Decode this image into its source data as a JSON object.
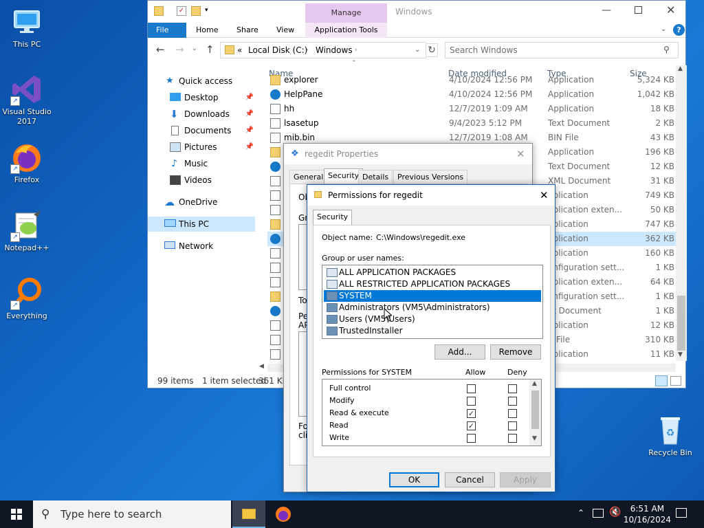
{
  "desktop": {
    "icons": [
      {
        "label": "This PC",
        "icon": "monitor-icon"
      },
      {
        "label": "Visual Studio 2017",
        "icon": "visual-studio-icon"
      },
      {
        "label": "Firefox",
        "icon": "firefox-icon"
      },
      {
        "label": "Notepad++",
        "icon": "notepad-plus-plus-icon"
      },
      {
        "label": "Everything",
        "icon": "everything-search-icon"
      },
      {
        "label": "Recycle Bin",
        "icon": "recycle-bin-icon"
      }
    ]
  },
  "explorer": {
    "title": "Windows",
    "manage_label": "Manage",
    "tabs": [
      "File",
      "Home",
      "Share",
      "View",
      "Application Tools"
    ],
    "breadcrumb": [
      "Local Disk (C:)",
      "Windows"
    ],
    "breadcrumb_prefix": "«",
    "search_placeholder": "Search Windows",
    "columns": {
      "name": "Name",
      "date": "Date modified",
      "type": "Type",
      "size": "Size"
    },
    "nav": [
      {
        "label": "Quick access",
        "icon": "star-icon",
        "pinned": false
      },
      {
        "label": "Desktop",
        "icon": "desktop-folder-icon",
        "pinned": true
      },
      {
        "label": "Downloads",
        "icon": "download-arrow-icon",
        "pinned": true
      },
      {
        "label": "Documents",
        "icon": "documents-icon",
        "pinned": true
      },
      {
        "label": "Pictures",
        "icon": "pictures-icon",
        "pinned": true
      },
      {
        "label": "Music",
        "icon": "music-note-icon",
        "pinned": false
      },
      {
        "label": "Videos",
        "icon": "videos-icon",
        "pinned": false
      },
      {
        "label": "OneDrive",
        "icon": "cloud-icon",
        "pinned": false
      },
      {
        "label": "This PC",
        "icon": "monitor-icon",
        "pinned": false
      },
      {
        "label": "Network",
        "icon": "network-icon",
        "pinned": false
      }
    ],
    "files": [
      {
        "name": "explorer",
        "date": "4/10/2024 12:56 PM",
        "type": "Application",
        "size": "5,324 KB"
      },
      {
        "name": "HelpPane",
        "date": "4/10/2024 12:56 PM",
        "type": "Application",
        "size": "1,042 KB"
      },
      {
        "name": "hh",
        "date": "12/7/2019 1:09 AM",
        "type": "Application",
        "size": "18 KB"
      },
      {
        "name": "lsasetup",
        "date": "9/4/2023 5:12 PM",
        "type": "Text Document",
        "size": "2 KB"
      },
      {
        "name": "mib.bin",
        "date": "12/7/2019 1:08 AM",
        "type": "BIN File",
        "size": "43 KB"
      },
      {
        "name": "",
        "date": "",
        "type": "Application",
        "size": "196 KB"
      },
      {
        "name": "",
        "date": "",
        "type": "Text Document",
        "size": "12 KB"
      },
      {
        "name": "",
        "date": "",
        "type": "XML Document",
        "size": "31 KB"
      },
      {
        "name": "",
        "date": "",
        "type": "pplication",
        "size": "749 KB"
      },
      {
        "name": "",
        "date": "",
        "type": "pplication exten...",
        "size": "50 KB"
      },
      {
        "name": "",
        "date": "",
        "type": "pplication",
        "size": "747 KB"
      },
      {
        "name": "",
        "date": "",
        "type": "pplication",
        "size": "362 KB"
      },
      {
        "name": "",
        "date": "",
        "type": "pplication",
        "size": "160 KB"
      },
      {
        "name": "",
        "date": "",
        "type": "onfiguration sett...",
        "size": "1 KB"
      },
      {
        "name": "",
        "date": "",
        "type": "pplication exten...",
        "size": "64 KB"
      },
      {
        "name": "",
        "date": "",
        "type": "onfiguration sett...",
        "size": "1 KB"
      },
      {
        "name": "",
        "date": "",
        "type": "xt Document",
        "size": "1 KB"
      },
      {
        "name": "",
        "date": "",
        "type": "pplication",
        "size": "12 KB"
      },
      {
        "name": "",
        "date": "",
        "type": "X File",
        "size": "310 KB"
      },
      {
        "name": "",
        "date": "",
        "type": "pplication",
        "size": "11 KB"
      }
    ],
    "status": {
      "items": "99 items",
      "selected": "1 item selected",
      "size": "361 KB"
    }
  },
  "props_dialog": {
    "title": "regedit Properties",
    "tabs": [
      "General",
      "Security",
      "Details",
      "Previous Versions"
    ],
    "partial_labels": [
      "Ob",
      "Gr",
      "To",
      "Pe",
      "AP",
      "Fo",
      "cli"
    ]
  },
  "perm_dialog": {
    "title": "Permissions for regedit",
    "tab": "Security",
    "object_name_label": "Object name:",
    "object_name_value": "C:\\Windows\\regedit.exe",
    "group_label": "Group or user names:",
    "groups": [
      {
        "name": "ALL APPLICATION PACKAGES",
        "selected": false
      },
      {
        "name": "ALL RESTRICTED APPLICATION PACKAGES",
        "selected": false
      },
      {
        "name": "SYSTEM",
        "selected": true
      },
      {
        "name": "Administrators (VM5\\Administrators)",
        "selected": false
      },
      {
        "name": "Users (VM5\\Users)",
        "selected": false
      },
      {
        "name": "TrustedInstaller",
        "selected": false
      }
    ],
    "add_button": "Add...",
    "remove_button": "Remove",
    "perm_label": "Permissions for SYSTEM",
    "allow_label": "Allow",
    "deny_label": "Deny",
    "permissions": [
      {
        "name": "Full control",
        "allow": false,
        "deny": false
      },
      {
        "name": "Modify",
        "allow": false,
        "deny": false
      },
      {
        "name": "Read & execute",
        "allow": true,
        "deny": false
      },
      {
        "name": "Read",
        "allow": true,
        "deny": false
      },
      {
        "name": "Write",
        "allow": false,
        "deny": false
      }
    ],
    "ok_button": "OK",
    "cancel_button": "Cancel",
    "apply_button": "Apply"
  },
  "taskbar": {
    "search_placeholder": "Type here to search",
    "time": "6:51 AM",
    "date": "10/16/2024"
  }
}
